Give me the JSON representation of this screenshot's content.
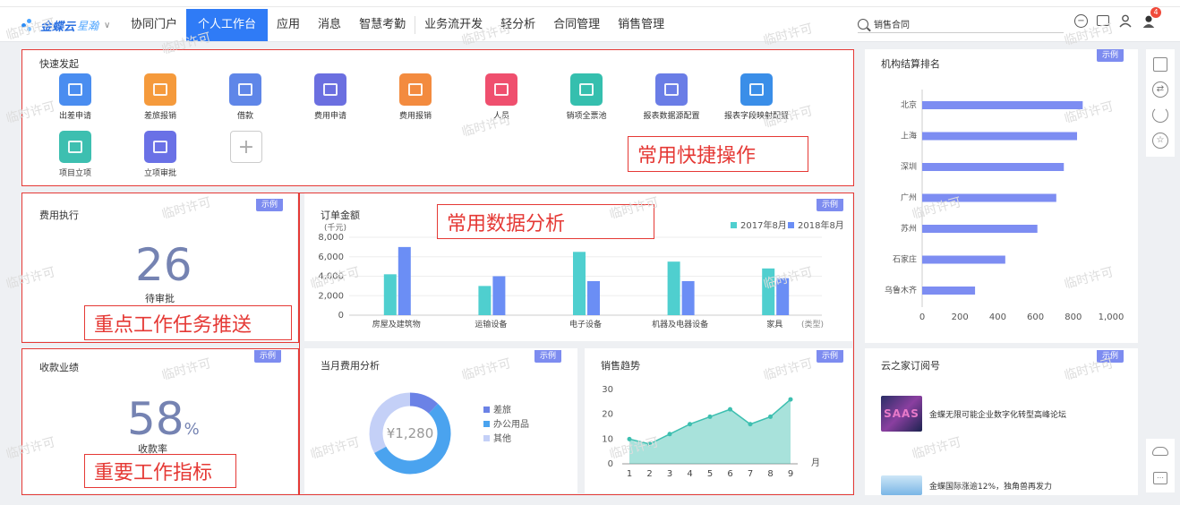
{
  "header": {
    "logo_text": "金蝶云",
    "logo_sub": "星瀚",
    "nav": [
      "协同门户",
      "个人工作台",
      "应用",
      "消息",
      "智慧考勤",
      "业务流开发",
      "轻分析",
      "合同管理",
      "销售管理"
    ],
    "active_index": 1,
    "search_text": "销售合同",
    "badge_count": "4"
  },
  "watermark_text": "临时许可",
  "sample_tag": "示例",
  "quick_launch": {
    "title": "快速发起",
    "items": [
      {
        "label": "出差申请",
        "color": "#4a8df0",
        "icon": "suitcase-icon"
      },
      {
        "label": "差旅报销",
        "color": "#f59a3c",
        "icon": "plane-ticket-icon"
      },
      {
        "label": "借款",
        "color": "#5f86e8",
        "icon": "money-icon"
      },
      {
        "label": "费用申请",
        "color": "#6b6fe0",
        "icon": "yuan-doc-icon"
      },
      {
        "label": "费用报销",
        "color": "#f38b3f",
        "icon": "reimburse-icon"
      },
      {
        "label": "人员",
        "color": "#ef4f6e",
        "icon": "person-icon"
      },
      {
        "label": "销项全票池",
        "color": "#35bfae",
        "icon": "invoice-icon"
      },
      {
        "label": "报表数据源配置",
        "color": "#6a7de6",
        "icon": "report-config-icon"
      },
      {
        "label": "报表字段映射配置",
        "color": "#3a8ee8",
        "icon": "sliders-icon"
      },
      {
        "label": "项目立项",
        "color": "#3dbfb0",
        "icon": "project-icon"
      },
      {
        "label": "立项审批",
        "color": "#6a71e6",
        "icon": "approval-icon"
      }
    ],
    "add_symbol": "+"
  },
  "annotations": {
    "quick": "常用快捷操作",
    "analysis": "常用数据分析",
    "push": "重点工作任务推送",
    "kpi": "重要工作指标"
  },
  "expense_exec": {
    "title": "费用执行",
    "value": "26",
    "caption": "待审批"
  },
  "collection": {
    "title": "收款业绩",
    "value": "58",
    "unit": "%",
    "caption": "收款率"
  },
  "order_amount": {
    "title": "订单金额"
  },
  "monthly_expense": {
    "title": "当月费用分析",
    "center_label": "¥1,280"
  },
  "sales_trend": {
    "title": "销售趋势"
  },
  "branch_rank": {
    "title": "机构结算排名"
  },
  "subscriptions": {
    "title": "云之家订阅号",
    "items": [
      {
        "text": "金蝶无限可能企业数字化转型高峰论坛",
        "badge": "SAAS"
      },
      {
        "text": "金蝶国际涨逾12%，独角兽再发力"
      }
    ]
  },
  "chart_data": [
    {
      "type": "bar",
      "title": "订单金额",
      "ylabel": "(千元)",
      "xlabel": "(类型)",
      "categories": [
        "房屋及建筑物",
        "运输设备",
        "电子设备",
        "机器及电器设备",
        "家具"
      ],
      "series": [
        {
          "name": "2017年8月",
          "values": [
            4200,
            3000,
            6500,
            5500,
            4800
          ],
          "color": "#4fcfcf"
        },
        {
          "name": "2018年8月",
          "values": [
            7000,
            4000,
            3500,
            3500,
            3800
          ],
          "color": "#6b8ef5"
        }
      ],
      "yticks": [
        "0",
        "2,000",
        "4,000",
        "6,000",
        "8,000"
      ],
      "ylim": [
        0,
        8000
      ],
      "legend": "top-right"
    },
    {
      "type": "pie",
      "title": "当月费用分析",
      "center_label": "¥1,280",
      "slices": [
        {
          "name": "差旅",
          "value": 12,
          "color": "#6b82e6"
        },
        {
          "name": "办公用品",
          "value": 55,
          "color": "#4aa3ef"
        },
        {
          "name": "其他",
          "value": 33,
          "color": "#c4d0f7"
        }
      ]
    },
    {
      "type": "area",
      "title": "销售趋势",
      "xlabel": "月",
      "x": [
        1,
        2,
        3,
        4,
        5,
        6,
        7,
        8,
        9
      ],
      "values": [
        10,
        8,
        12,
        16,
        19,
        22,
        16,
        19,
        26
      ],
      "yticks": [
        "0",
        "10",
        "20",
        "30"
      ],
      "ylim": [
        0,
        30
      ],
      "color": "#3dbfb0"
    },
    {
      "type": "bar",
      "title": "机构结算排名",
      "orientation": "horizontal",
      "categories": [
        "北京",
        "上海",
        "深圳",
        "广州",
        "苏州",
        "石家庄",
        "乌鲁木齐"
      ],
      "values": [
        850,
        820,
        750,
        710,
        610,
        440,
        280
      ],
      "xticks": [
        "0",
        "200",
        "400",
        "600",
        "800",
        "1,000"
      ],
      "xlim": [
        0,
        1000
      ],
      "color": "#7d8df2"
    }
  ]
}
